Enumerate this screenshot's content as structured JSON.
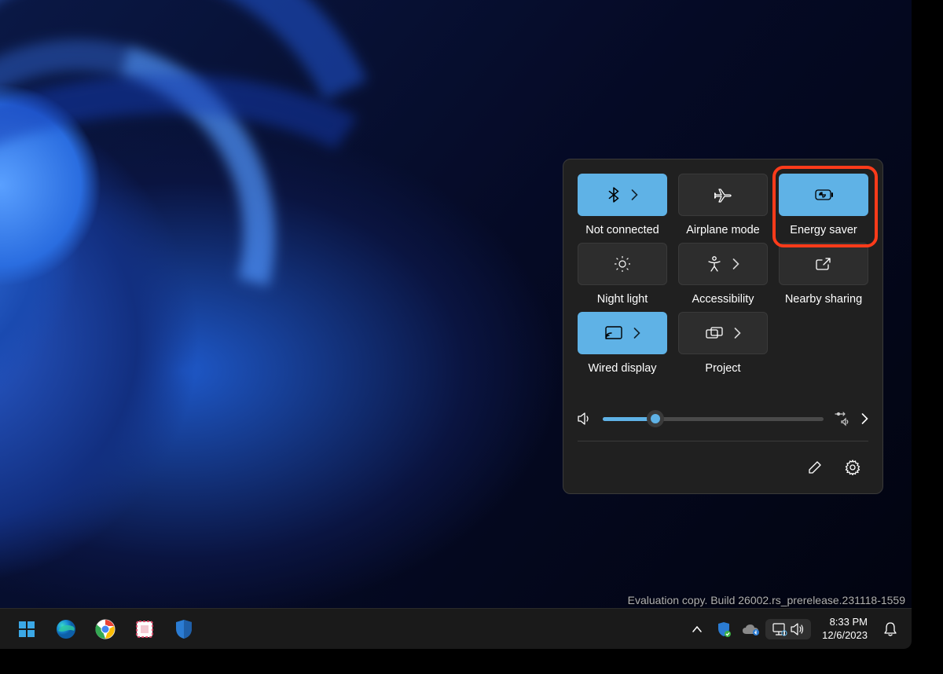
{
  "quick_settings": {
    "tiles": {
      "bluetooth": {
        "label": "Not connected",
        "active": true,
        "has_chevron": true
      },
      "airplane": {
        "label": "Airplane mode",
        "active": false,
        "has_chevron": false
      },
      "energy": {
        "label": "Energy saver",
        "active": true,
        "has_chevron": false
      },
      "nightlight": {
        "label": "Night light",
        "active": false,
        "has_chevron": false
      },
      "accessibility": {
        "label": "Accessibility",
        "active": false,
        "has_chevron": true
      },
      "nearby": {
        "label": "Nearby sharing",
        "active": false,
        "has_chevron": false
      },
      "cast": {
        "label": "Wired display",
        "active": true,
        "has_chevron": true
      },
      "project": {
        "label": "Project",
        "active": false,
        "has_chevron": true
      }
    },
    "volume_percent": 24
  },
  "watermark": "Evaluation copy. Build 26002.rs_prerelease.231118-1559",
  "taskbar": {
    "time": "8:33 PM",
    "date": "12/6/2023"
  }
}
